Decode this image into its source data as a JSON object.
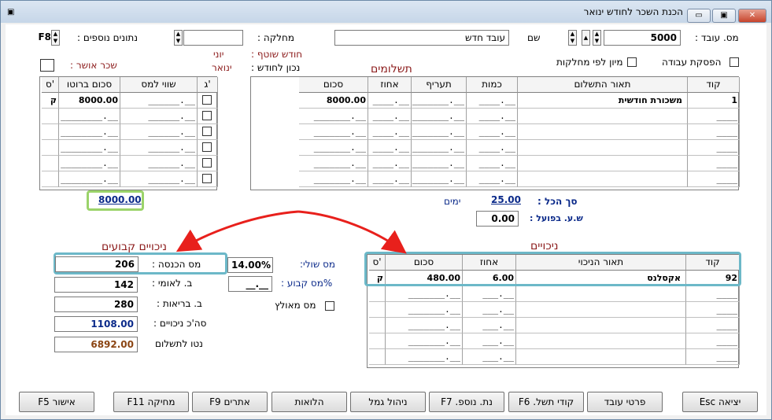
{
  "window": {
    "title": "הכנת השכר לחודש ינואר",
    "minimize": "▭",
    "maximize": "▣",
    "close": "✕"
  },
  "header": {
    "employee_label": "מס. עובד :",
    "employee_value": "5000",
    "name_label": "שם",
    "name_value": "עובד חדש",
    "department_label": "מחלקה :",
    "department_value": "",
    "extra_label": "נתונים נוספים :",
    "extra_value": "F8",
    "current_month_label": "חודש שוטף :",
    "current_month_value": "יוני",
    "correct_for_label": "נכון לחודש :",
    "correct_for_value": "ינואר",
    "approved_wage_label": "שכר אושר :",
    "work_stop_label": "הפסקת עבודה",
    "sort_dept_label": "מיון לפי מחלקות"
  },
  "payments": {
    "title": "תשלומים",
    "columns": [
      "קוד",
      "תאור התשלום",
      "כמות",
      "תעריף",
      "אחוז",
      "סכום",
      "ג'",
      "שווי למס",
      "סכום ברוטו",
      "ס'"
    ],
    "rows": [
      {
        "code": "1",
        "desc": "משכורת חודשית",
        "qty": "____.__",
        "rate": "_______.__",
        "pct": "____.__",
        "sum": "8000.00",
        "value": "______.__",
        "gross": "8000.00",
        "s": "ק"
      },
      {
        "code": "____",
        "desc": "",
        "qty": "____.__",
        "rate": "_______.__",
        "pct": "____.__",
        "sum": "_______.__",
        "value": "______.__",
        "gross": "________.__",
        "s": ""
      },
      {
        "code": "____",
        "desc": "",
        "qty": "____.__",
        "rate": "_______.__",
        "pct": "____.__",
        "sum": "_______.__",
        "value": "______.__",
        "gross": "________.__",
        "s": ""
      },
      {
        "code": "____",
        "desc": "",
        "qty": "____.__",
        "rate": "_______.__",
        "pct": "____.__",
        "sum": "_______.__",
        "value": "______.__",
        "gross": "________.__",
        "s": ""
      },
      {
        "code": "____",
        "desc": "",
        "qty": "____.__",
        "rate": "_______.__",
        "pct": "____.__",
        "sum": "_______.__",
        "value": "______.__",
        "gross": "________.__",
        "s": ""
      },
      {
        "code": "____",
        "desc": "",
        "qty": "____.__",
        "rate": "_______.__",
        "pct": "____.__",
        "sum": "_______.__",
        "value": "______.__",
        "gross": "________.__",
        "s": ""
      }
    ],
    "gross_total": "8000.00",
    "total_label": "סך הכל :",
    "total_value": "25.00",
    "days_label": "ימים",
    "actual_hours_label": "ש.ע. בפועל :",
    "actual_hours_value": "0.00"
  },
  "fixed_deductions": {
    "title": "ניכויים קבועים",
    "income_tax_label": "מס הכנסה :",
    "income_tax_value": "206",
    "national_ins_label": "ב. לאומי :",
    "national_ins_value": "142",
    "health_ins_label": "ב. בריאות :",
    "health_ins_value": "280",
    "total_deductions_label": "סה'כ ניכויים :",
    "total_deductions_value": "1108.00",
    "net_label": "נטו לתשלום",
    "net_value": "6892.00",
    "marginal_tax_label": "מס שולי:",
    "marginal_tax_value": "14.00%",
    "fixed_tax_label": "%מס קבוע :",
    "fixed_tax_value": "__.__",
    "paid_tax_label": "מס מאולץ"
  },
  "deductions": {
    "title": "ניכויים",
    "columns": [
      "קוד",
      "תאור הניכוי",
      "אחוז",
      "סכום",
      "ס'"
    ],
    "rows": [
      {
        "code": "92",
        "desc": "אקסלנס",
        "pct": "6.00",
        "sum": "480.00",
        "s": "ק"
      },
      {
        "code": "____",
        "desc": "",
        "pct": "___.__",
        "sum": "_______.__",
        "s": ""
      },
      {
        "code": "____",
        "desc": "",
        "pct": "___.__",
        "sum": "_______.__",
        "s": ""
      },
      {
        "code": "____",
        "desc": "",
        "pct": "___.__",
        "sum": "_______.__",
        "s": ""
      },
      {
        "code": "____",
        "desc": "",
        "pct": "___.__",
        "sum": "_______.__",
        "s": ""
      },
      {
        "code": "____",
        "desc": "",
        "pct": "___.__",
        "sum": "_______.__",
        "s": ""
      }
    ]
  },
  "buttons": {
    "exit": "יציאה Esc",
    "emp_details": "פרטי עובד",
    "pay_codes": "קודי תשל. F6",
    "extra_data": "נת. נוספ. F7",
    "fund": "ניהול גמל",
    "loans": "הלואות",
    "searches": "אתרים F9",
    "delete": "מחיקה F11",
    "approve": "אישור F5"
  },
  "colors": {
    "highlight": "#6cb8c8",
    "highlight_green": "#9bd36a",
    "arrow": "#e8201c"
  }
}
